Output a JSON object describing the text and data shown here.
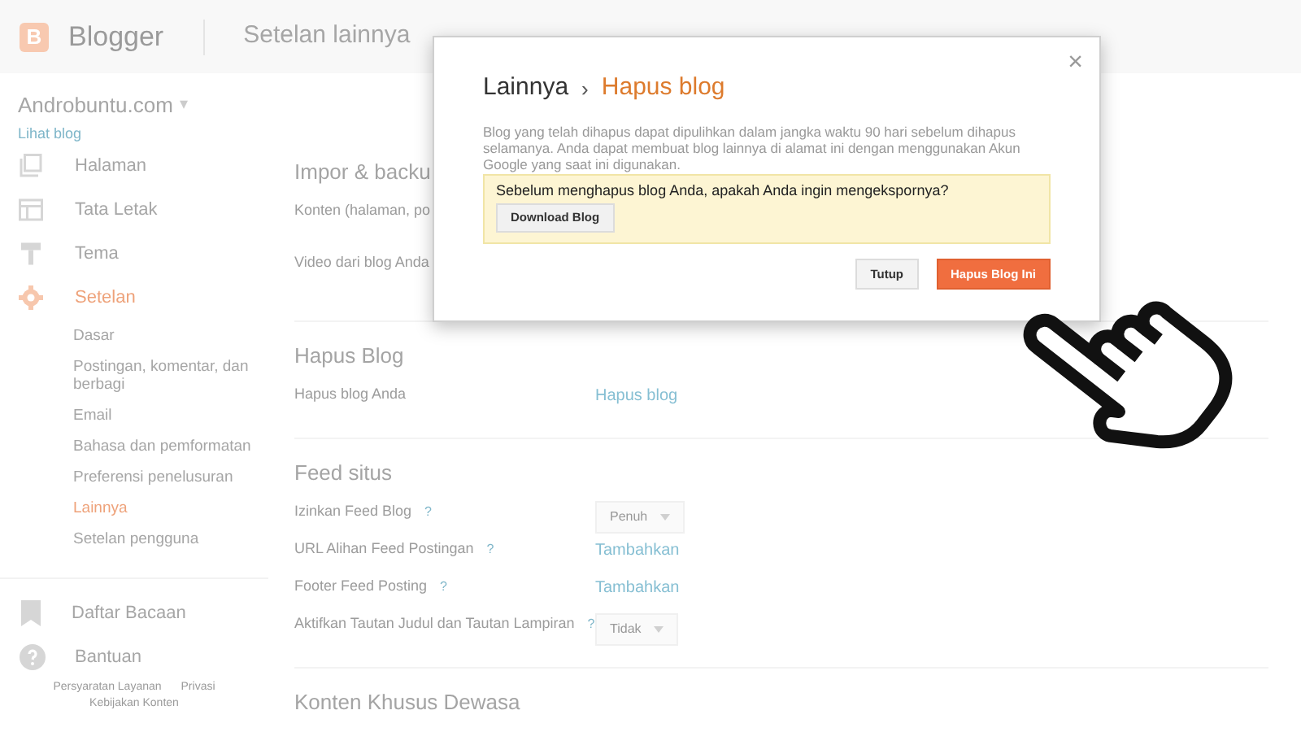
{
  "header": {
    "logo_letter": "B",
    "logo_text": "Blogger",
    "title": "Setelan lainnya"
  },
  "sidebar": {
    "blog_name": "Androbuntu.com",
    "caret": "▾",
    "view_link": "Lihat blog",
    "items": [
      {
        "label": "Halaman",
        "selected": false
      },
      {
        "label": "Tata Letak",
        "selected": false
      },
      {
        "label": "Tema",
        "selected": false
      },
      {
        "label": "Setelan",
        "selected": true,
        "children": [
          {
            "label": "Dasar",
            "selected": false
          },
          {
            "label": "Postingan, komentar, dan berbagi",
            "selected": false
          },
          {
            "label": "Email",
            "selected": false
          },
          {
            "label": "Bahasa dan pemformatan",
            "selected": false
          },
          {
            "label": "Preferensi penelusuran",
            "selected": false
          },
          {
            "label": "Lainnya",
            "selected": true
          },
          {
            "label": "Setelan pengguna",
            "selected": false
          }
        ]
      }
    ],
    "bottom_items": [
      {
        "label": "Daftar Bacaan"
      },
      {
        "label": "Bantuan"
      }
    ],
    "footer_links": [
      "Persyaratan Layanan",
      "Privasi",
      "Kebijakan Konten"
    ]
  },
  "sections": [
    {
      "title": "Impor & backu",
      "rows": [
        {
          "label": "Konten (halaman, po"
        },
        {
          "label": "Video dari blog Anda"
        }
      ]
    },
    {
      "title": "Hapus Blog",
      "rows": [
        {
          "label": "Hapus blog Anda",
          "value": {
            "kind": "link",
            "text": "Hapus blog"
          }
        }
      ]
    },
    {
      "title": "Feed situs",
      "rows": [
        {
          "label": "Izinkan Feed Blog",
          "help": "?",
          "value": {
            "kind": "select",
            "text": "Penuh"
          }
        },
        {
          "label": "URL Alihan Feed Postingan",
          "help": "?",
          "value": {
            "kind": "link",
            "text": "Tambahkan"
          }
        },
        {
          "label": "Footer Feed Posting",
          "help": "?",
          "value": {
            "kind": "link",
            "text": "Tambahkan"
          }
        },
        {
          "label": "Aktifkan Tautan Judul dan Tautan Lampiran",
          "help": "?",
          "value": {
            "kind": "select",
            "text": "Tidak"
          }
        }
      ]
    },
    {
      "title": "Konten Khusus Dewasa"
    }
  ],
  "dialog": {
    "close": "×",
    "parent": "Lainnya",
    "separator": "›",
    "title": "Hapus blog",
    "body": "Blog yang telah dihapus dapat dipulihkan dalam jangka waktu 90 hari sebelum dihapus selamanya. Anda dapat membuat blog lainnya di alamat ini dengan menggunakan Akun Google yang saat ini digunakan.",
    "notice": {
      "text": "Sebelum menghapus blog Anda, apakah Anda ingin mengekspornya?",
      "button": "Download Blog"
    },
    "buttons": [
      {
        "label": "Tutup",
        "kind": "secondary"
      },
      {
        "label": "Hapus Blog Ini",
        "kind": "primary"
      }
    ]
  }
}
